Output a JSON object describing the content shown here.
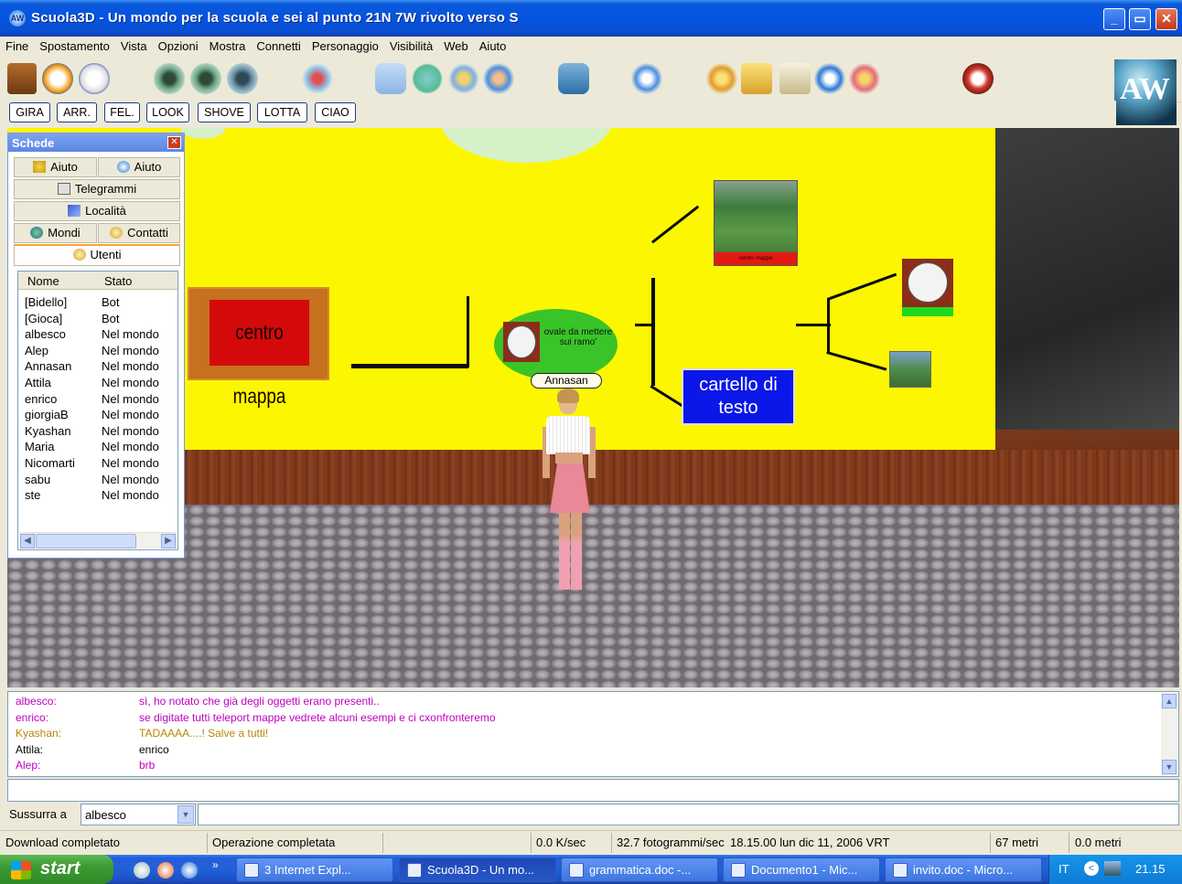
{
  "window": {
    "title": "Scuola3D - Un mondo per la scuola e sei al punto 21N 7W rivolto verso S",
    "app_icon": "aw-globe-icon",
    "controls": [
      "minimize",
      "maximize",
      "close"
    ]
  },
  "menu": [
    "Fine",
    "Spostamento",
    "Vista",
    "Opzioni",
    "Mostra",
    "Connetti",
    "Personaggio",
    "Visibilità",
    "Web",
    "Aiuto"
  ],
  "gestures": [
    "GIRA",
    "ARR.",
    "FEL.",
    "LOOK",
    "SHOVE",
    "LOTTA",
    "CIAO"
  ],
  "schede": {
    "title": "Schede",
    "tabs": {
      "aiuto1": "Aiuto",
      "aiuto2": "Aiuto",
      "telegrammi": "Telegrammi",
      "localita": "Località",
      "mondi": "Mondi",
      "contatti": "Contatti",
      "utenti": "Utenti"
    },
    "columns": {
      "name": "Nome",
      "status": "Stato"
    },
    "users": [
      {
        "name": "[Bidello]",
        "status": "Bot"
      },
      {
        "name": "[Gioca]",
        "status": "Bot"
      },
      {
        "name": "albesco",
        "status": "Nel mondo"
      },
      {
        "name": "Alep",
        "status": "Nel mondo"
      },
      {
        "name": "Annasan",
        "status": "Nel mondo"
      },
      {
        "name": "Attila",
        "status": "Nel mondo"
      },
      {
        "name": "enrico",
        "status": "Nel mondo"
      },
      {
        "name": "giorgiaB",
        "status": "Nel mondo"
      },
      {
        "name": "Kyashan",
        "status": "Nel mondo"
      },
      {
        "name": "Maria",
        "status": "Nel mondo"
      },
      {
        "name": "Nicomarti",
        "status": "Nel mondo"
      },
      {
        "name": "sabu",
        "status": "Nel mondo"
      },
      {
        "name": "ste",
        "status": "Nel mondo"
      }
    ]
  },
  "scene": {
    "sign_red": "centro mappa",
    "oval_text": "ovale da mettere sui ramo'",
    "avatar_name": "Annasan",
    "blue_sign": "cartello di testo",
    "pic_label": "centro mappa"
  },
  "chat": [
    {
      "who": "albesco:",
      "msg": "sì, ho notato che già degli oggetti erano presenti..",
      "color": "#c000c0"
    },
    {
      "who": "enrico:",
      "msg": "se digitate tutti  teleport mappe  vedrete alcuni esempi e ci cxonfronteremo",
      "color": "#c000c0"
    },
    {
      "who": "Kyashan:",
      "msg": "TADAAAA....! Salve a tutti!",
      "color": "#b8860b"
    },
    {
      "who": "Attila:",
      "msg": "enrico",
      "color": "#000000"
    },
    {
      "who": "Alep:",
      "msg": "brb",
      "color": "#c000c0"
    }
  ],
  "whisper": {
    "label": "Sussurra a",
    "target": "albesco"
  },
  "status": {
    "download": "Download completato",
    "operation": "Operazione completata",
    "rate": "0.0 K/sec",
    "fps": "32.7 fotogrammi/sec",
    "datetime": "18.15.00 lun dic 11, 2006 VRT",
    "distance": "67 metri",
    "elevation": "0.0 metri"
  },
  "taskbar": {
    "start": "start",
    "items": [
      "3 Internet Expl...",
      "Scuola3D - Un mo...",
      "grammatica.doc -...",
      "Documento1 - Mic...",
      "invito.doc - Micro..."
    ],
    "lang": "IT",
    "clock": "21.15"
  }
}
